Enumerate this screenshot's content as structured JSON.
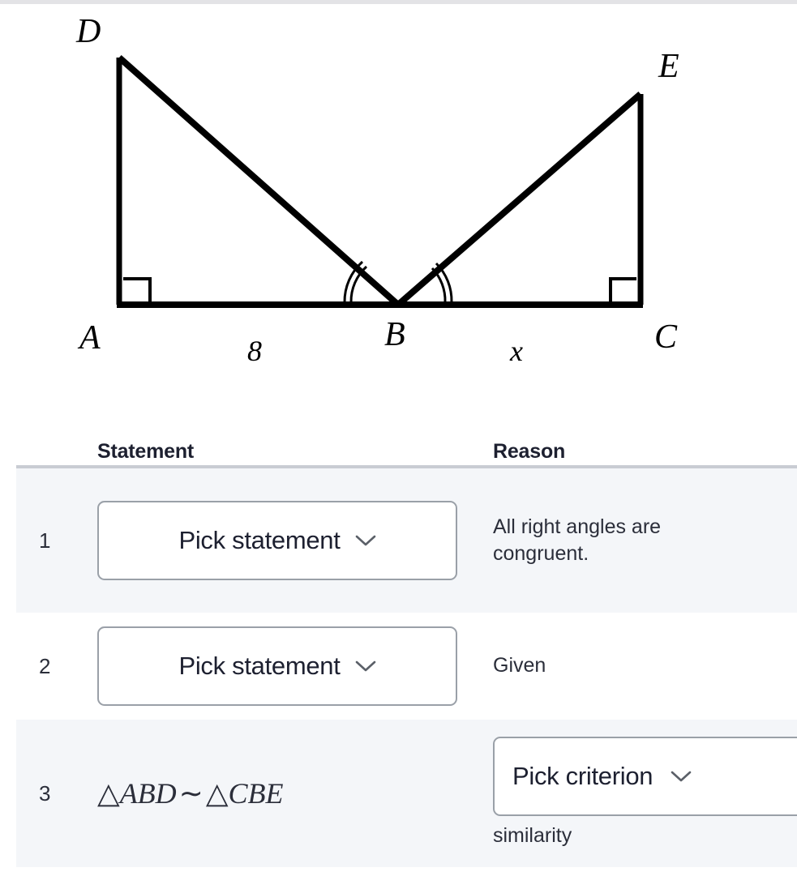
{
  "figure": {
    "caption_labels": {
      "D": "D",
      "E": "E",
      "A": "A",
      "B": "B",
      "C": "C"
    },
    "side_lengths": {
      "AB": "8",
      "BC": "x"
    },
    "right_angle_marks": [
      "A",
      "C"
    ],
    "angle_arc_marks": [
      "ABD",
      "CBE"
    ],
    "stroke_color": "#000000"
  },
  "table": {
    "headers": {
      "number": "",
      "statement": "Statement",
      "reason": "Reason"
    },
    "rows": [
      {
        "number": "1",
        "statement_type": "dropdown",
        "statement_value": "Pick statement",
        "reason_type": "text",
        "reason_lines": [
          "All right angles are",
          "congruent."
        ]
      },
      {
        "number": "2",
        "statement_type": "dropdown",
        "statement_value": "Pick statement",
        "reason_type": "text",
        "reason_lines": [
          "Given"
        ]
      },
      {
        "number": "3",
        "statement_type": "math",
        "statement_value": "△ABD ∼ △CBE",
        "statement_parts": {
          "tri1": "△",
          "name1": "ABD",
          "sim": "∼",
          "tri2": "△",
          "name2": "CBE"
        },
        "reason_type": "dropdown",
        "reason_value": "Pick criterion",
        "reason_suffix": "similarity"
      }
    ]
  },
  "icons": {
    "chevron_down": "chevron-down-icon"
  },
  "colors": {
    "row_shaded": "#f4f6f9",
    "row_plain": "#ffffff",
    "rule": "#c9ccd3",
    "text": "#2b2e3a",
    "border": "#9aa0a8",
    "top_strip": "#e3e3e6"
  }
}
